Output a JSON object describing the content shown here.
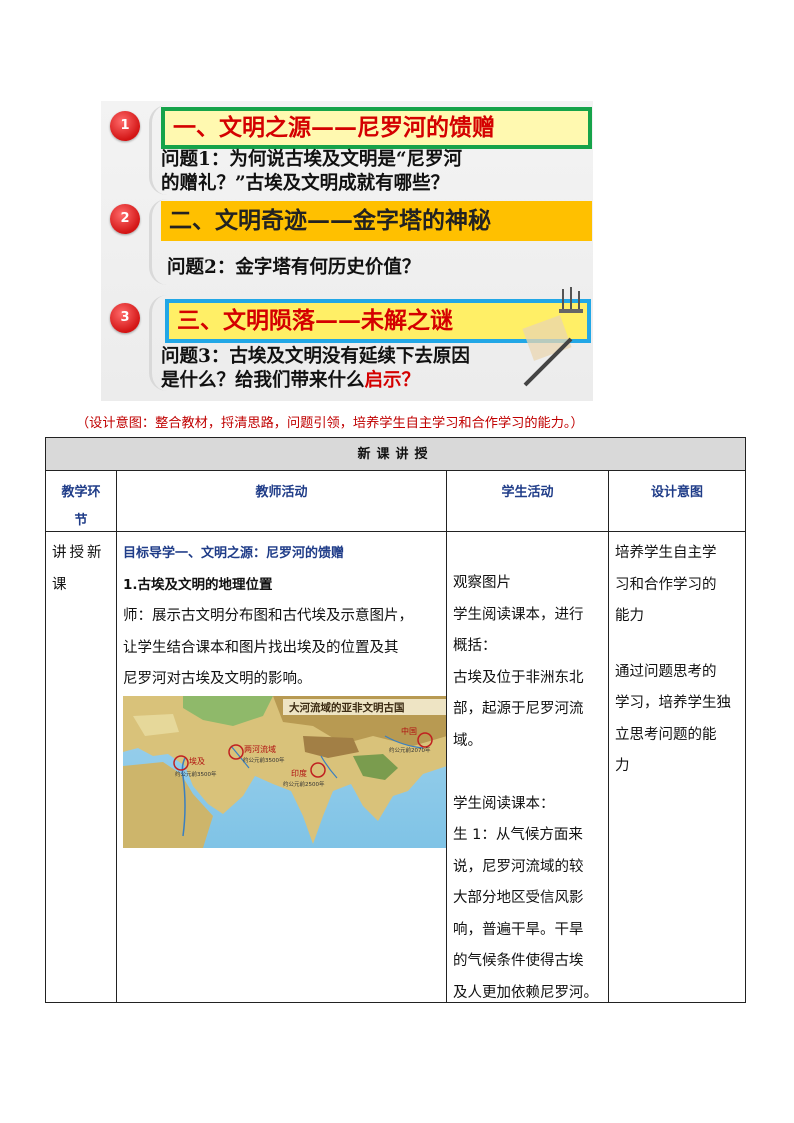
{
  "slide": {
    "items": [
      {
        "num": "1",
        "title": "一、文明之源——尼罗河的馈赠",
        "question_line1": "问题1：为何说古埃及文明是“尼罗河",
        "question_line2": "的赠礼？”古埃及文明成就有哪些？"
      },
      {
        "num": "2",
        "title": "二、文明奇迹——金字塔的神秘",
        "question_line1": "问题2：金字塔有何历史价值？"
      },
      {
        "num": "3",
        "title": "三、文明陨落——未解之谜",
        "question_line1": "问题3：古埃及文明没有延续下去原因",
        "question_line2a": "是什么？给我们带来什么",
        "question_line2b": "启示？"
      }
    ]
  },
  "caption": "（设计意图：整合教材，捋清思路，问题引领，培养学生自主学习和合作学习的能力。）",
  "table": {
    "header": "新课讲授",
    "columns": [
      "教学环节",
      "教师活动",
      "学生活动",
      "设计意图"
    ],
    "col1_line1": "教学环",
    "col1_line2": "节",
    "stage_line1": "讲授新",
    "stage_line2": "课",
    "teacher": {
      "goal": "目标导学一、文明之源：尼罗河的馈赠",
      "subtitle": "1.古埃及文明的地理位置",
      "lines": [
        "师：展示古文明分布图和古代埃及示意图片，",
        "让学生结合课本和图片找出埃及的位置及其",
        "尼罗河对古埃及文明的影响。"
      ]
    },
    "map": {
      "title": "大河流域的亚非文明古国",
      "labels": {
        "egypt": "埃及",
        "mesopotamia": "两河流域",
        "india": "印度",
        "china": "中国"
      },
      "notes": {
        "egypt": "约公元前3500年",
        "mesopotamia": "约公元前3500年",
        "india": "约公元前2500年",
        "china": "约公元前2070年"
      }
    },
    "student": {
      "lines": [
        "观察图片",
        "学生阅读课本，进行",
        "概括：",
        "古埃及位于非洲东北",
        "部，起源于尼罗河流",
        "域。",
        "",
        "学生阅读课本：",
        "生 1：从气候方面来",
        "说，尼罗河流域的较",
        "大部分地区受信风影",
        "响，普遍干旱。干旱",
        "的气候条件使得古埃",
        "及人更加依赖尼罗河。"
      ]
    },
    "design": {
      "lines": [
        "培养学生自主学",
        "习和合作学习的",
        "能力",
        "",
        "通过问题思考的",
        "学习，培养学生独",
        "立思考问题的能",
        "力"
      ]
    }
  },
  "colors": {
    "red": "#d40000",
    "green": "#16a34a",
    "orange": "#ffc000",
    "blue": "#22a7e6",
    "navy": "#1f3c88"
  }
}
